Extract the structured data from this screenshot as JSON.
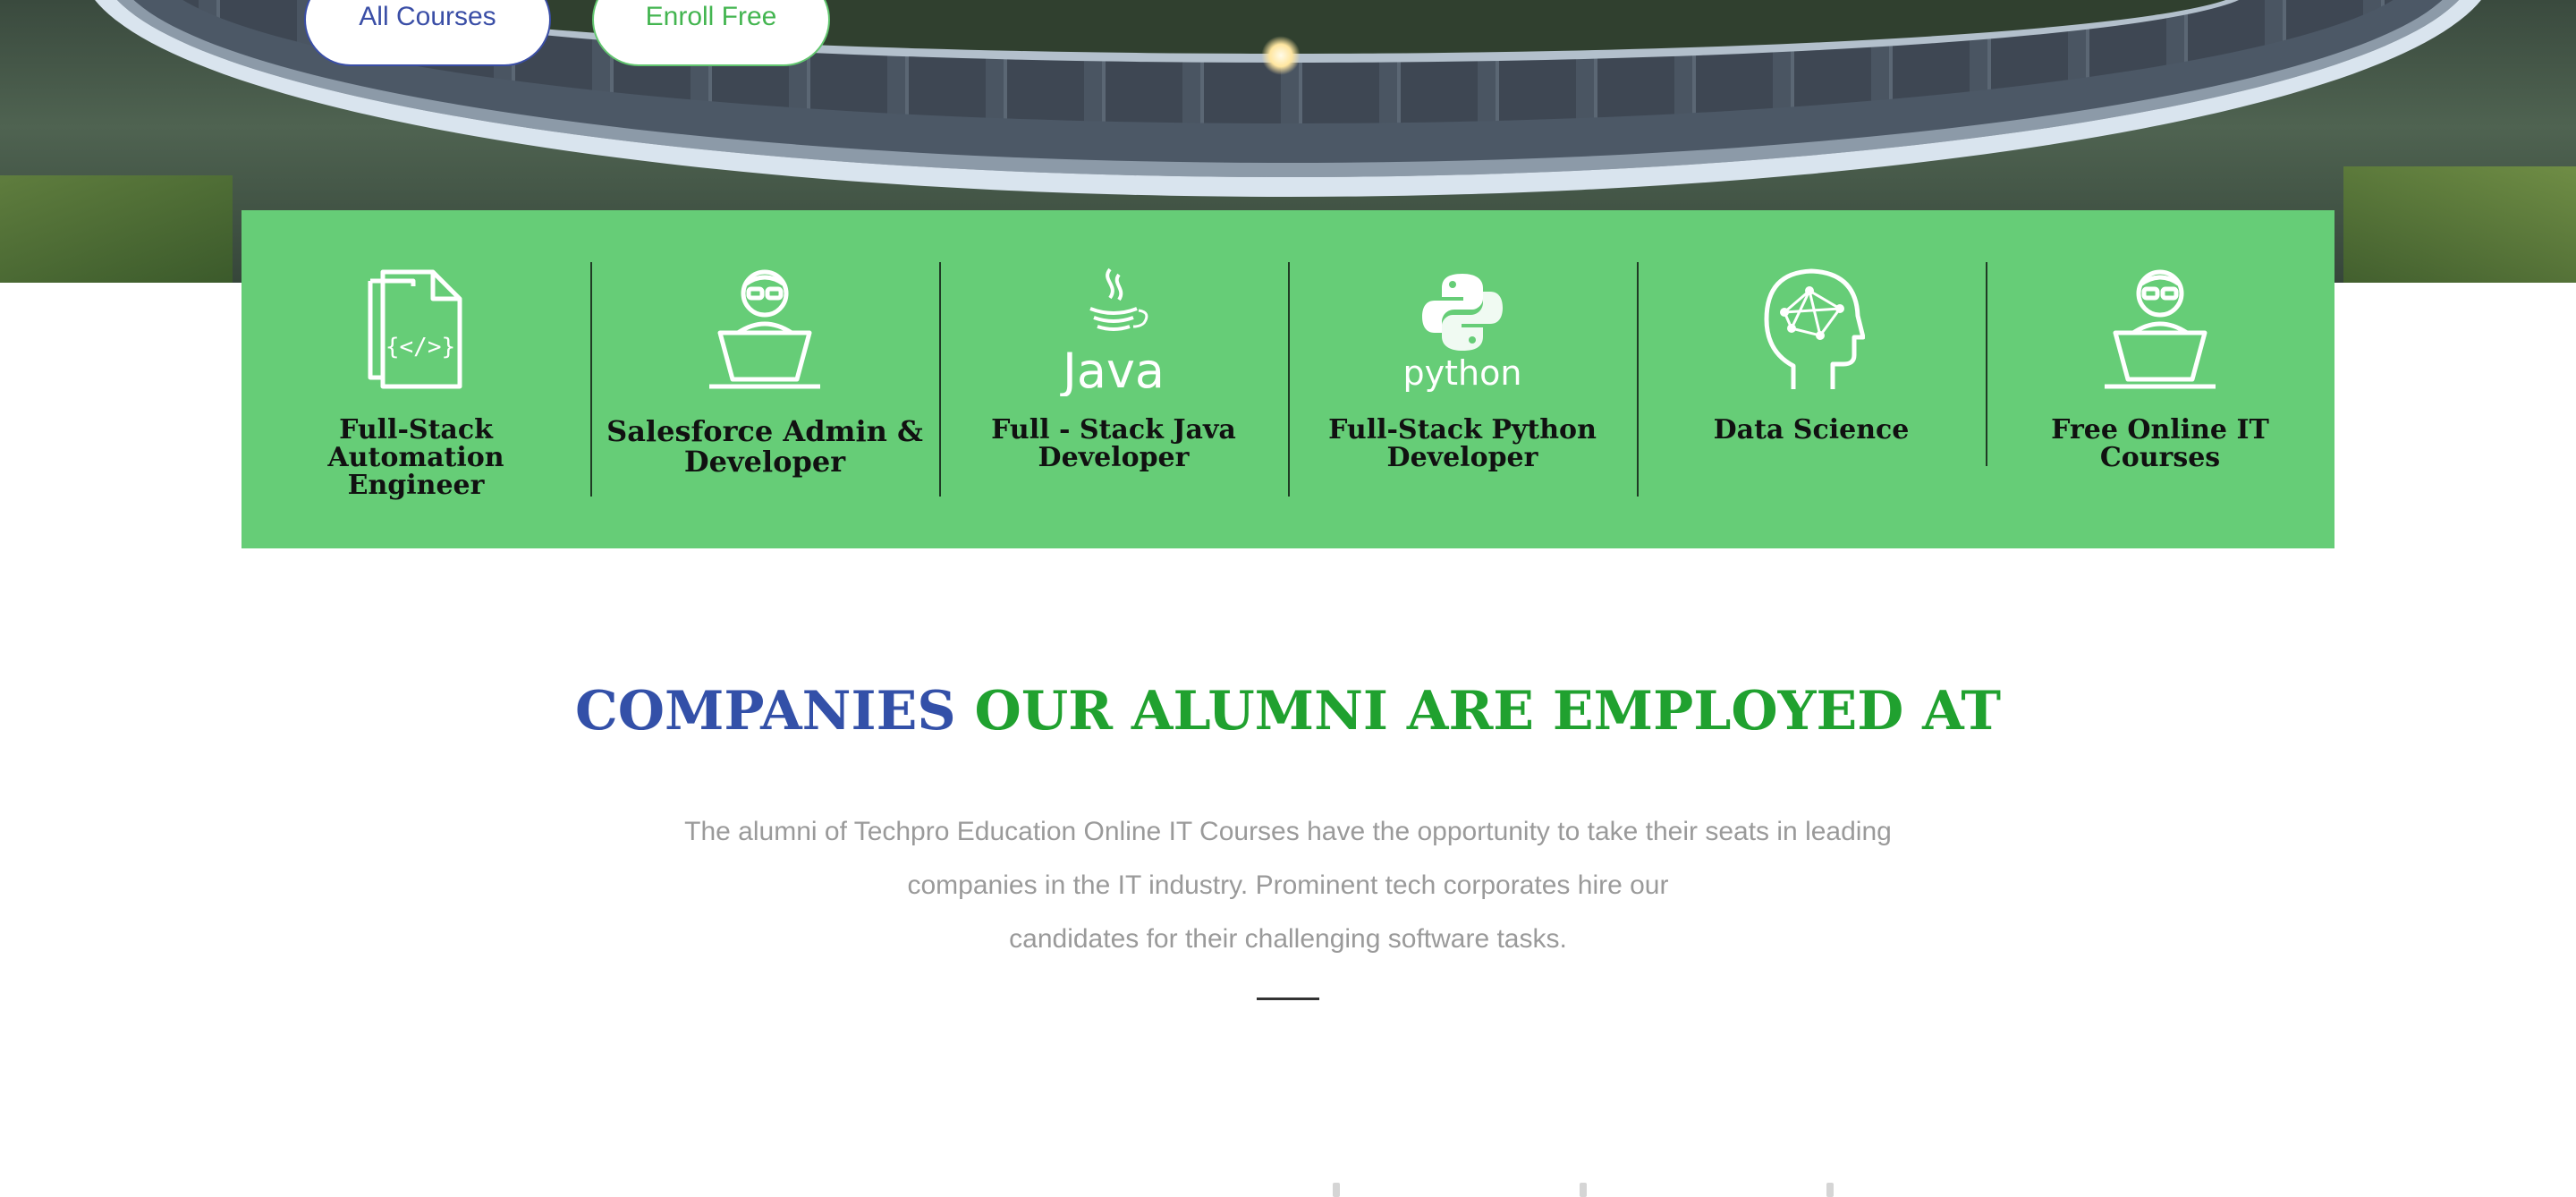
{
  "hero": {
    "buttons": {
      "all_courses": "All Courses",
      "enroll_free": "Enroll Free"
    }
  },
  "courses": [
    {
      "label": "Full-Stack Automation Engineer",
      "icon": "code-document-icon"
    },
    {
      "label": "Salesforce Admin & Developer",
      "icon": "developer-laptop-icon"
    },
    {
      "label": "Full - Stack Java Developer",
      "icon": "java-logo-icon"
    },
    {
      "label": "Full-Stack Python Developer",
      "icon": "python-logo-icon"
    },
    {
      "label": "Data Science",
      "icon": "brain-network-icon"
    },
    {
      "label": "Free Online IT Courses",
      "icon": "developer-laptop-icon"
    }
  ],
  "companies": {
    "heading_part1": "COMPANIES",
    "heading_part2": "OUR ALUMNI ARE EMPLOYED AT",
    "description_lines": [
      "The alumni of Techpro Education Online IT Courses have the opportunity to take their seats in leading",
      "companies in the IT industry. Prominent tech corporates hire our",
      "candidates for their challenging software tasks."
    ]
  },
  "colors": {
    "brand_blue": "#3350a8",
    "brand_green": "#20a12f",
    "strip_green": "#66cd77",
    "body_text_gray": "#9a9a9a"
  }
}
